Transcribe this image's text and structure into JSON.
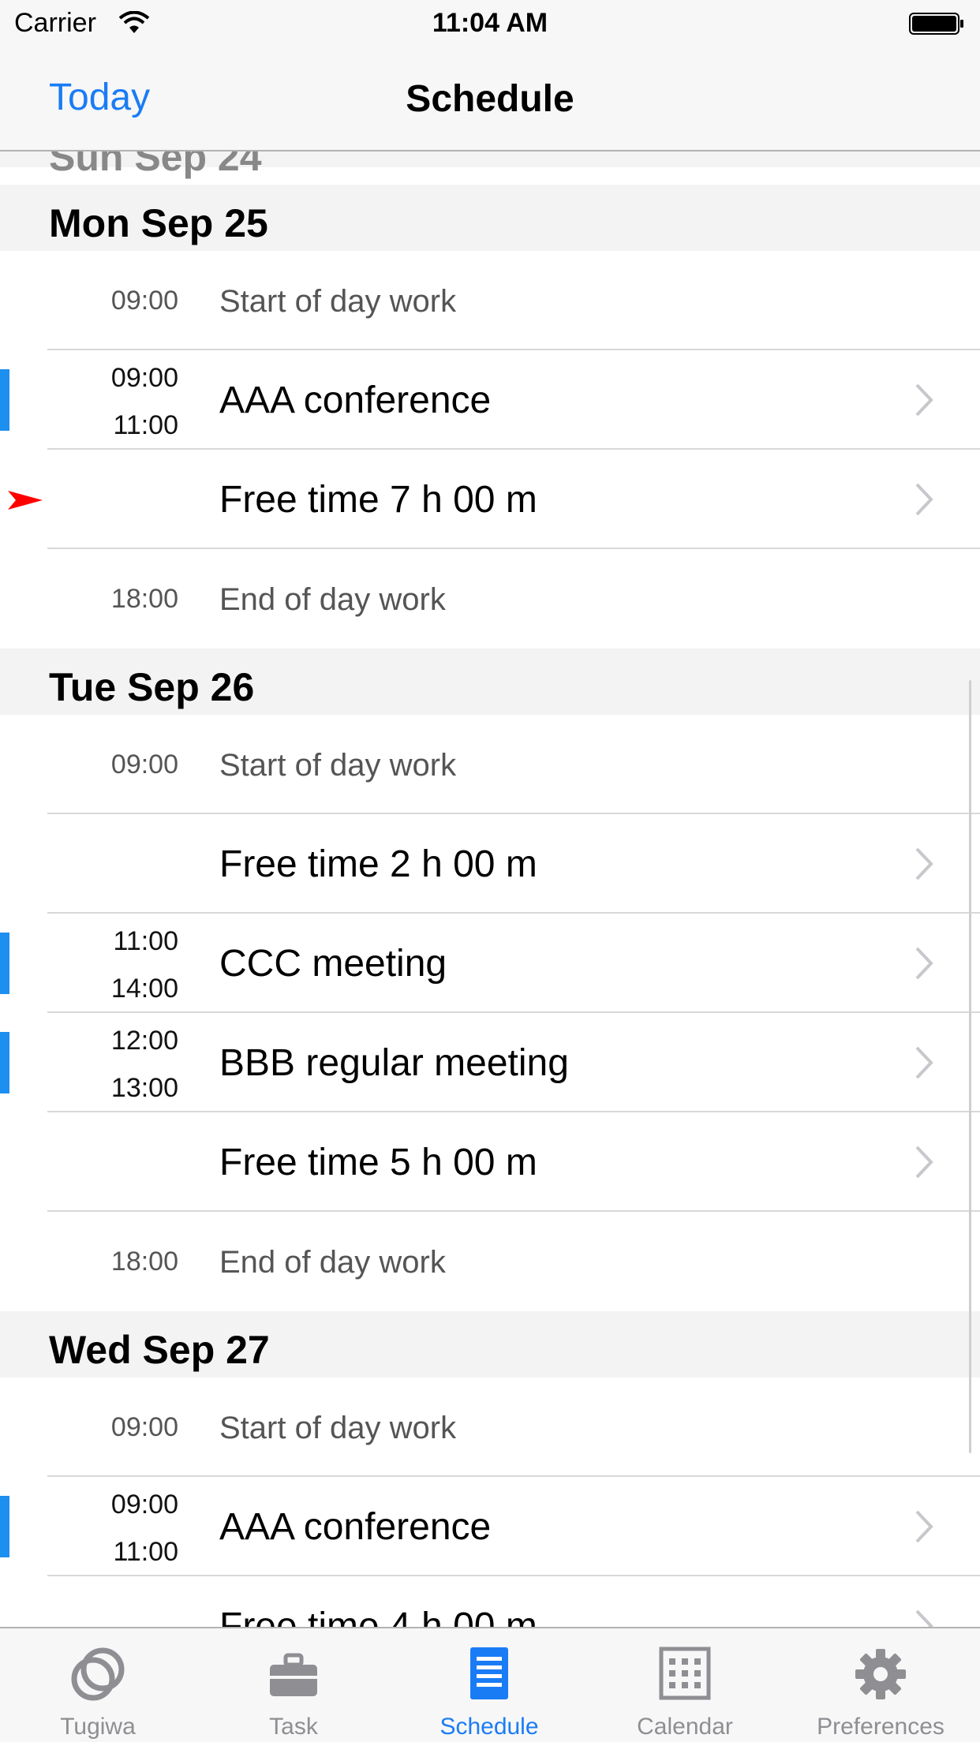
{
  "status_bar": {
    "carrier": "Carrier",
    "time": "11:04 AM"
  },
  "nav": {
    "left_button": "Today",
    "title": "Schedule"
  },
  "sections": [
    {
      "header": "Sun Sep 24"
    },
    {
      "header": "Mon Sep 25",
      "rows": [
        {
          "time": "09:00",
          "title": "Start of day work"
        },
        {
          "start": "09:00",
          "end": "11:00",
          "title": "AAA conference"
        },
        {
          "title": "Free time 7 h 00 m"
        },
        {
          "time": "18:00",
          "title": "End of day work"
        }
      ]
    },
    {
      "header": "Tue Sep 26",
      "rows": [
        {
          "time": "09:00",
          "title": "Start of day work"
        },
        {
          "title": "Free time 2 h 00 m"
        },
        {
          "start": "11:00",
          "end": "14:00",
          "title": "CCC meeting"
        },
        {
          "start": "12:00",
          "end": "13:00",
          "title": "BBB regular meeting"
        },
        {
          "title": "Free time 5 h 00 m"
        },
        {
          "time": "18:00",
          "title": "End of day work"
        }
      ]
    },
    {
      "header": "Wed Sep 27",
      "rows": [
        {
          "time": "09:00",
          "title": "Start of day work"
        },
        {
          "start": "09:00",
          "end": "11:00",
          "title": "AAA conference"
        },
        {
          "title": "Free time 4 h 00 m"
        }
      ]
    }
  ],
  "tabs": [
    {
      "label": "Tugiwa",
      "icon": "rings-icon"
    },
    {
      "label": "Task",
      "icon": "briefcase-icon"
    },
    {
      "label": "Schedule",
      "icon": "document-list-icon",
      "active": true
    },
    {
      "label": "Calendar",
      "icon": "calendar-grid-icon"
    },
    {
      "label": "Preferences",
      "icon": "gear-icon"
    }
  ],
  "colors": {
    "accent": "#1a7cf5",
    "event_bar": "#1d8ff0",
    "current_marker": "#ff0000"
  }
}
